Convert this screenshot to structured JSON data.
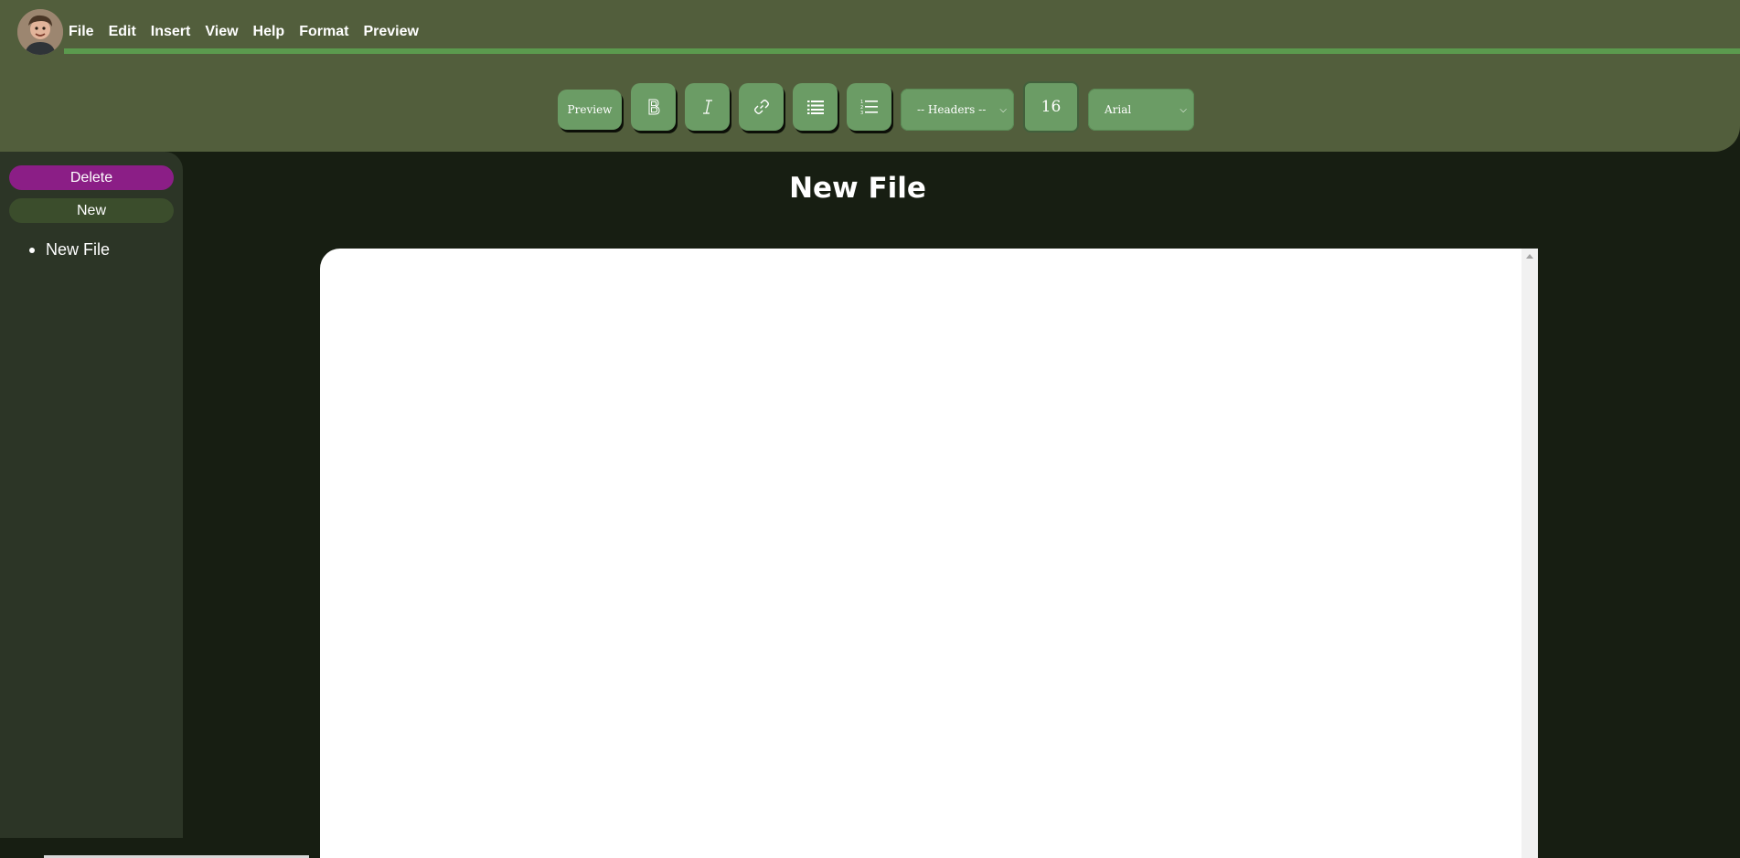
{
  "header": {
    "menu": [
      "File",
      "Edit",
      "Insert",
      "View",
      "Help",
      "Format",
      "Preview"
    ]
  },
  "toolbar": {
    "preview_label": "Preview",
    "headers_select": "-- Headers --",
    "font_size": "16",
    "font_select": "Arial"
  },
  "sidebar": {
    "delete_label": "Delete",
    "new_label": "New",
    "files": [
      "New File"
    ]
  },
  "document": {
    "title": "New File"
  },
  "colors": {
    "header_bg": "#525e3c",
    "accent_line": "#5b9a4e",
    "button_green": "#6b9c65",
    "delete_purple": "#8b1e86",
    "new_green": "#3b4d2c",
    "sidebar_bg": "#2c3526",
    "page_bg": "#171e12"
  }
}
